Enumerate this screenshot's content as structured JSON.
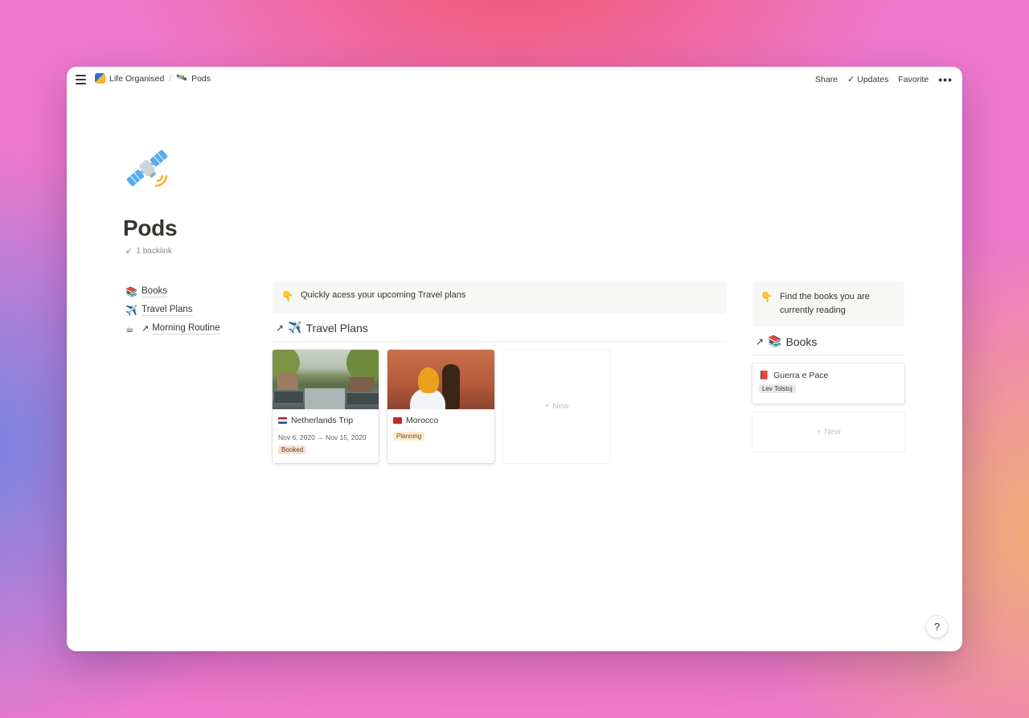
{
  "breadcrumb": {
    "workspace": "Life Organised",
    "separator": "/",
    "page": "Pods"
  },
  "actions": {
    "share": "Share",
    "updates": "Updates",
    "favorite": "Favorite",
    "more": "•••"
  },
  "page": {
    "title": "Pods",
    "backlinks": "1 backlink"
  },
  "left_links": [
    {
      "emoji": "📚",
      "label": "Books"
    },
    {
      "emoji": "✈️",
      "label": "Travel Plans"
    },
    {
      "emoji": "☕",
      "label": "Morning Routine"
    }
  ],
  "travel": {
    "callout_icon": "👇",
    "callout": "Quickly acess your upcoming Travel plans",
    "heading_emoji": "✈️",
    "heading": "Travel Plans",
    "cards": [
      {
        "title": "Netherlands Trip",
        "date": "Nov 6, 2020 → Nov 15, 2020",
        "tag": "Booked",
        "tag_color": "#fbdfd2"
      },
      {
        "title": "Morocco",
        "tag": "Planning",
        "tag_color": "#fbeccc"
      }
    ],
    "new_label": "New"
  },
  "books": {
    "callout_icon": "👇",
    "callout": "Find the books you are currently reading",
    "heading_emoji": "📚",
    "heading": "Books",
    "card": {
      "emoji": "📕",
      "title": "Guerra e Pace",
      "author": "Lev Tolstoj"
    },
    "new_label": "New"
  },
  "help": "?",
  "colors": {
    "text": "#37352f",
    "callout_bg": "#f7f7f5",
    "tag_booked": "#fbdfd2",
    "tag_planning": "#fbeccc",
    "tag_author": "#e9e9e7"
  }
}
